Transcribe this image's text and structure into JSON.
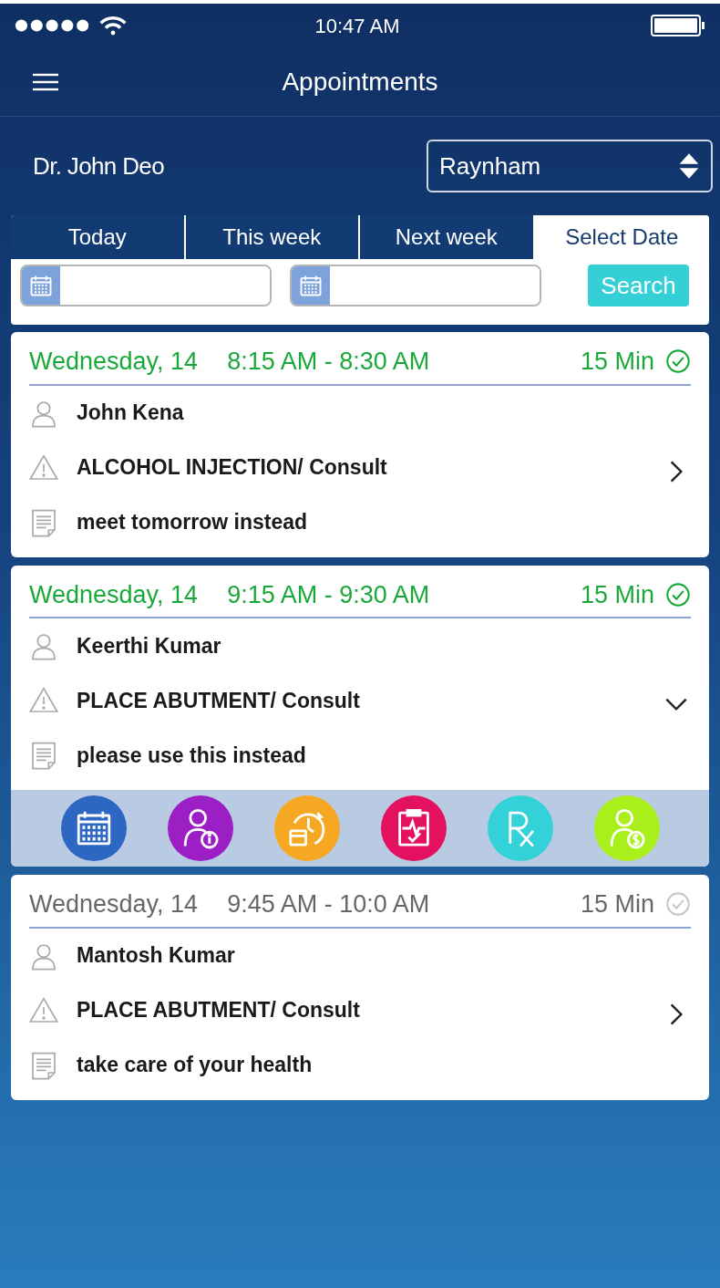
{
  "status_bar": {
    "time": "10:47 AM"
  },
  "header": {
    "title": "Appointments"
  },
  "doctor": {
    "name": "Dr. John Deo"
  },
  "location_select": {
    "value": "Raynham"
  },
  "tabs": [
    {
      "label": "Today",
      "selected": false
    },
    {
      "label": "This week",
      "selected": false
    },
    {
      "label": "Next week",
      "selected": false
    },
    {
      "label": "Select Date",
      "selected": true
    }
  ],
  "date_filter": {
    "search_button": "Search"
  },
  "appointments": [
    {
      "date": "Wednesday, 14",
      "time": "8:15 AM - 8:30 AM",
      "duration": "15 Min",
      "confirmed": true,
      "expanded": false,
      "patient": "John Kena",
      "procedure": "ALCOHOL INJECTION/ Consult",
      "note": "meet tomorrow instead"
    },
    {
      "date": "Wednesday, 14",
      "time": "9:15 AM - 9:30 AM",
      "duration": "15 Min",
      "confirmed": true,
      "expanded": true,
      "patient": "Keerthi Kumar",
      "procedure": "PLACE ABUTMENT/ Consult",
      "note": "please use this instead"
    },
    {
      "date": "Wednesday, 14",
      "time": "9:45 AM - 10:0 AM",
      "duration": "15 Min",
      "confirmed": false,
      "expanded": false,
      "patient": "Mantosh Kumar",
      "procedure": "PLACE ABUTMENT/ Consult",
      "note": "take care of your health"
    }
  ],
  "actions": [
    {
      "kind": "calendar",
      "color": "#2e66c4"
    },
    {
      "kind": "patient-info",
      "color": "#9b1fc4"
    },
    {
      "kind": "reschedule",
      "color": "#f7a823"
    },
    {
      "kind": "vitals",
      "color": "#e3115f"
    },
    {
      "kind": "prescription",
      "color": "#33d2d8"
    },
    {
      "kind": "billing",
      "color": "#a9ef1c"
    }
  ]
}
